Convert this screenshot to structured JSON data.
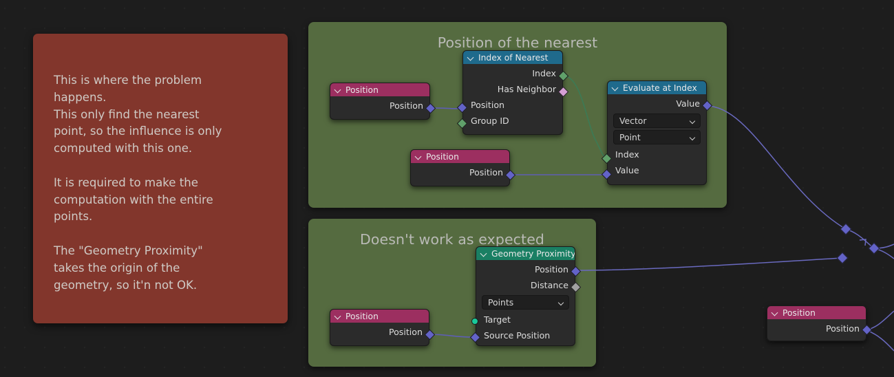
{
  "editor": {
    "background_color": "#1d1d1d",
    "frame_color": "#556b40",
    "note_color": "#82362c"
  },
  "note": {
    "name": "sticky-note",
    "text": "This is where the problem\nhappens.\nThis only find the nearest\npoint, so the influence is only\ncomputed with this one.\n\nIt is required to make the\ncomputation with the entire\npoints.\n\nThe \"Geometry Proximity\"\ntakes the origin of the\ngeometry, so it'n not OK."
  },
  "frames": [
    {
      "label": "Position of the nearest"
    },
    {
      "label": "Doesn't work as expected"
    }
  ],
  "nodes": {
    "position_a": {
      "title": "Position",
      "outputs": [
        {
          "label": "Position",
          "type": "vector"
        }
      ]
    },
    "position_b": {
      "title": "Position",
      "outputs": [
        {
          "label": "Position",
          "type": "vector"
        }
      ]
    },
    "position_c": {
      "title": "Position",
      "outputs": [
        {
          "label": "Position",
          "type": "vector"
        }
      ]
    },
    "position_d": {
      "title": "Position",
      "outputs": [
        {
          "label": "Position",
          "type": "vector"
        }
      ]
    },
    "index_of_nearest": {
      "title": "Index of Nearest",
      "outputs": [
        {
          "label": "Index",
          "type": "int"
        },
        {
          "label": "Has Neighbor",
          "type": "bool"
        }
      ],
      "inputs": [
        {
          "label": "Position",
          "type": "vector"
        },
        {
          "label": "Group ID",
          "type": "int"
        }
      ]
    },
    "evaluate_at_index": {
      "title": "Evaluate at Index",
      "outputs": [
        {
          "label": "Value",
          "type": "vector"
        }
      ],
      "dropdowns": [
        {
          "value": "Vector"
        },
        {
          "value": "Point"
        }
      ],
      "inputs": [
        {
          "label": "Index",
          "type": "int"
        },
        {
          "label": "Value",
          "type": "vector"
        }
      ]
    },
    "geometry_proximity": {
      "title": "Geometry Proximity",
      "outputs": [
        {
          "label": "Position",
          "type": "vector"
        },
        {
          "label": "Distance",
          "type": "float"
        }
      ],
      "dropdowns": [
        {
          "value": "Points"
        }
      ],
      "inputs": [
        {
          "label": "Target",
          "type": "geometry"
        },
        {
          "label": "Source Position",
          "type": "vector"
        }
      ]
    }
  },
  "socket_colors": {
    "vector": "#6363c7",
    "int": "#60a06a",
    "bool": "#d59fd5",
    "float": "#a1a1a1",
    "geometry": "#19c99a"
  }
}
